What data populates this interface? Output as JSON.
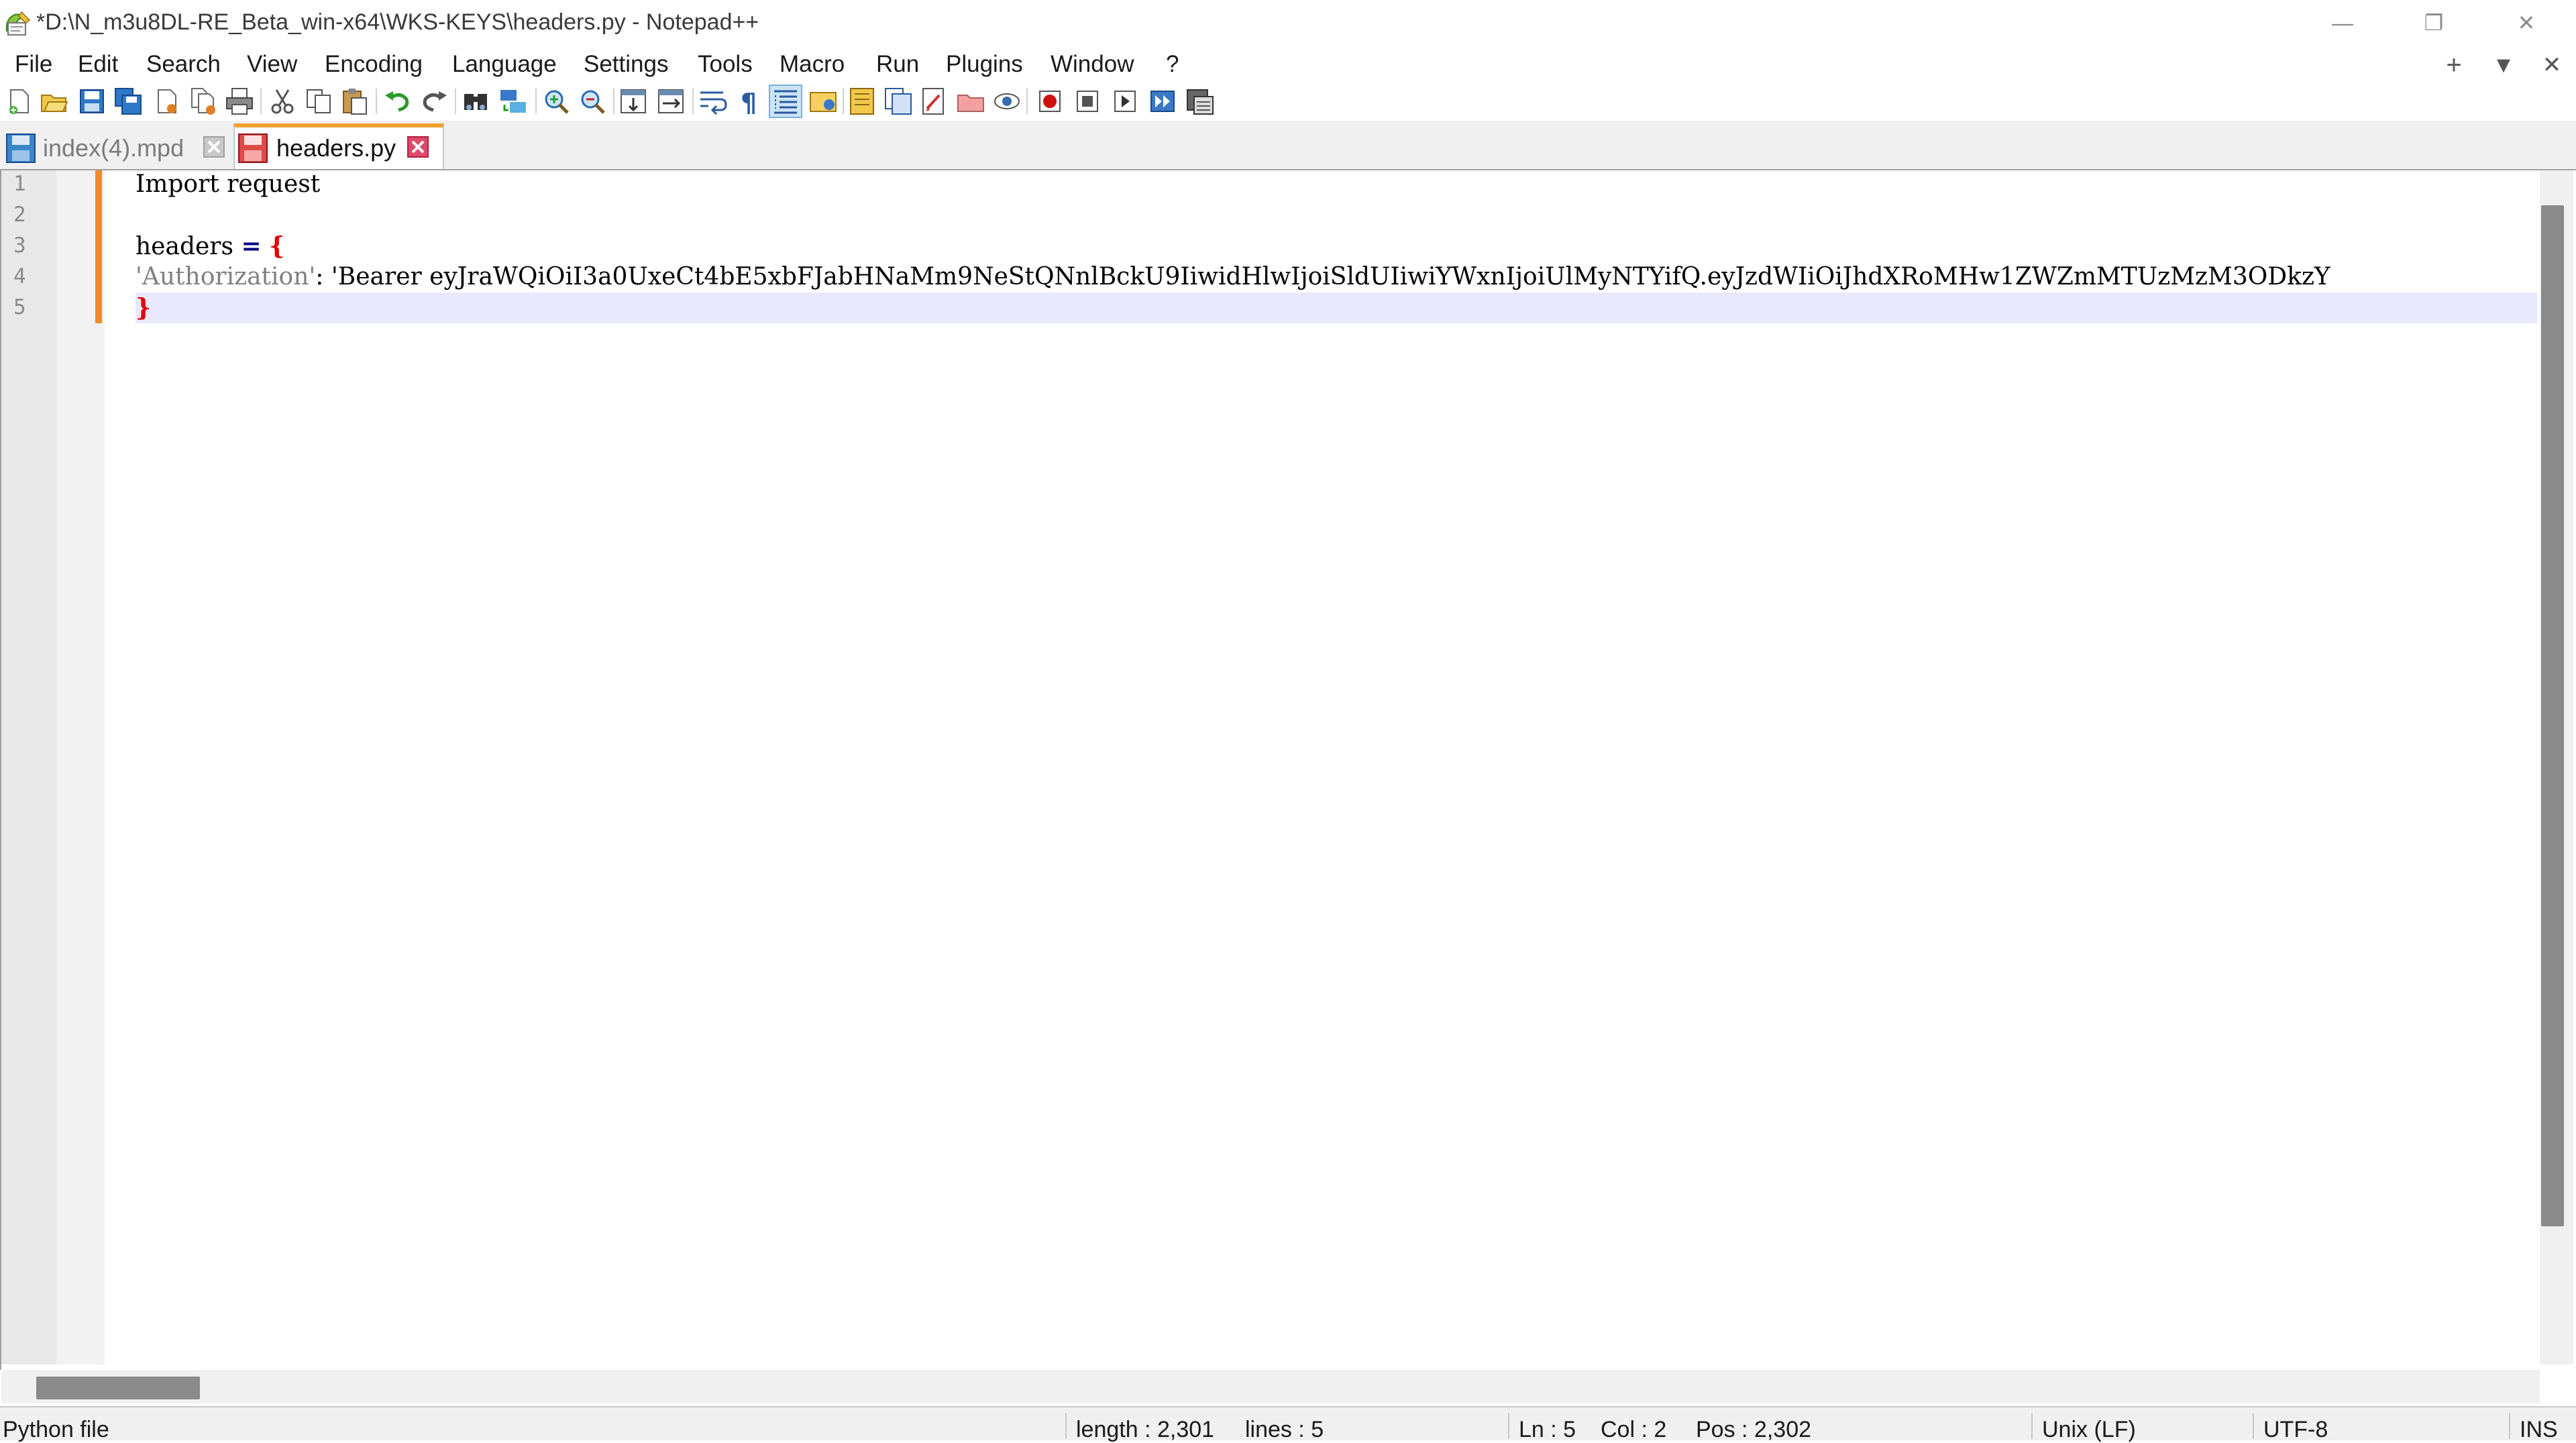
{
  "window": {
    "title": "*D:\\N_m3u8DL-RE_Beta_win-x64\\WKS-KEYS\\headers.py - Notepad++",
    "minimize_glyph": "—",
    "restore_glyph": "❐",
    "close_glyph": "✕"
  },
  "menu": {
    "items": [
      "File",
      "Edit",
      "Search",
      "View",
      "Encoding",
      "Language",
      "Settings",
      "Tools",
      "Macro",
      "Run",
      "Plugins",
      "Window",
      "?"
    ],
    "new_tab_glyph": "+",
    "dropdown_glyph": "▼",
    "close_doc_glyph": "✕"
  },
  "toolbar": {
    "icons": [
      "new-file-icon",
      "open-file-icon",
      "save-icon",
      "save-all-icon",
      "close-icon",
      "close-all-icon",
      "print-icon",
      "cut-icon",
      "copy-icon",
      "paste-icon",
      "undo-icon",
      "redo-icon",
      "find-icon",
      "replace-icon",
      "zoom-in-icon",
      "zoom-out-icon",
      "sync-vertical-icon",
      "sync-horizontal-icon",
      "word-wrap-icon",
      "show-all-chars-icon",
      "indent-guide-icon",
      "user-language-icon",
      "document-map-icon",
      "function-list-icon",
      "folder-workspace-icon",
      "folder-icon",
      "monitoring-icon",
      "record-macro-icon",
      "stop-macro-icon",
      "play-macro-icon",
      "run-macro-multiple-icon",
      "save-macro-icon"
    ]
  },
  "tabs": [
    {
      "label": "index(4).mpd",
      "active": false,
      "icon": "saved-file-icon"
    },
    {
      "label": "headers.py",
      "active": true,
      "icon": "unsaved-file-icon"
    }
  ],
  "editor": {
    "line_numbers": [
      "1",
      "2",
      "3",
      "4",
      "5"
    ],
    "lines": {
      "l1": "Import request",
      "l3_name": "headers ",
      "l3_op": "=",
      "l3_brace": "{",
      "l4_key": "'Authorization'",
      "l4_rest": ": 'Bearer eyJraWQiOiI3a0UxeCt4bE5xbFJabHNaMm9NeStQNnlBckU9IiwidHlwIjoiSldUIiwiYWxnIjoiUlMyNTYifQ.eyJzdWIiOiJhdXRoMHw1ZWZmMTUzMzM3ODkzY",
      "l5_brace": "}"
    },
    "changed_color": "#f08c28",
    "caret_line_color": "#e8e8ff"
  },
  "status": {
    "file_type": "Python file",
    "length": "length : 2,301",
    "lines": "lines : 5",
    "ln": "Ln : 5",
    "col": "Col : 2",
    "pos": "Pos : 2,302",
    "eol": "Unix (LF)",
    "encoding": "UTF-8",
    "mode": "INS"
  }
}
